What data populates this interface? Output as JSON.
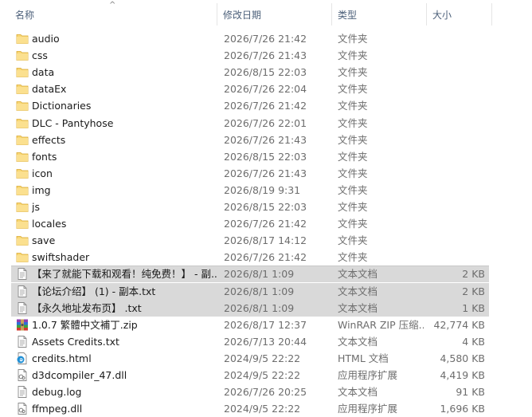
{
  "columns": {
    "name": "名称",
    "date": "修改日期",
    "type": "类型",
    "size": "大小",
    "sort_indicator": "^"
  },
  "colors": {
    "folder": "#f8d775",
    "selection": "#d9d9d9",
    "header_text": "#4c607a"
  },
  "files": [
    {
      "name": "audio",
      "date": "2026/7/26 21:42",
      "type": "文件夹",
      "size": "",
      "icon": "folder-icon",
      "selected": false
    },
    {
      "name": "css",
      "date": "2026/7/26 21:43",
      "type": "文件夹",
      "size": "",
      "icon": "folder-icon",
      "selected": false
    },
    {
      "name": "data",
      "date": "2026/8/15 22:03",
      "type": "文件夹",
      "size": "",
      "icon": "folder-icon",
      "selected": false
    },
    {
      "name": "dataEx",
      "date": "2026/7/26 22:04",
      "type": "文件夹",
      "size": "",
      "icon": "folder-icon",
      "selected": false
    },
    {
      "name": "Dictionaries",
      "date": "2026/7/26 21:42",
      "type": "文件夹",
      "size": "",
      "icon": "folder-icon",
      "selected": false
    },
    {
      "name": "DLC - Pantyhose",
      "date": "2026/7/26 22:01",
      "type": "文件夹",
      "size": "",
      "icon": "folder-icon",
      "selected": false
    },
    {
      "name": "effects",
      "date": "2026/7/26 21:43",
      "type": "文件夹",
      "size": "",
      "icon": "folder-icon",
      "selected": false
    },
    {
      "name": "fonts",
      "date": "2026/8/15 22:03",
      "type": "文件夹",
      "size": "",
      "icon": "folder-icon",
      "selected": false
    },
    {
      "name": "icon",
      "date": "2026/7/26 21:43",
      "type": "文件夹",
      "size": "",
      "icon": "folder-icon",
      "selected": false
    },
    {
      "name": "img",
      "date": "2026/8/19 9:31",
      "type": "文件夹",
      "size": "",
      "icon": "folder-icon",
      "selected": false
    },
    {
      "name": "js",
      "date": "2026/8/15 22:03",
      "type": "文件夹",
      "size": "",
      "icon": "folder-icon",
      "selected": false
    },
    {
      "name": "locales",
      "date": "2026/7/26 21:42",
      "type": "文件夹",
      "size": "",
      "icon": "folder-icon",
      "selected": false
    },
    {
      "name": "save",
      "date": "2026/8/17 14:12",
      "type": "文件夹",
      "size": "",
      "icon": "folder-icon",
      "selected": false
    },
    {
      "name": "swiftshader",
      "date": "2026/7/26 21:42",
      "type": "文件夹",
      "size": "",
      "icon": "folder-icon",
      "selected": false
    },
    {
      "name": "【来了就能下载和观看！纯免费！】 - 副...",
      "date": "2026/8/1 1:09",
      "type": "文本文档",
      "size": "2 KB",
      "icon": "text-file-icon",
      "selected": true
    },
    {
      "name": "【论坛介绍】 (1) - 副本.txt",
      "date": "2026/8/1 1:09",
      "type": "文本文档",
      "size": "2 KB",
      "icon": "text-file-icon",
      "selected": true
    },
    {
      "name": "【永久地址发布页】 .txt",
      "date": "2026/8/1 1:09",
      "type": "文本文档",
      "size": "1 KB",
      "icon": "text-file-icon",
      "selected": true
    },
    {
      "name": "1.0.7 繁體中文補丁.zip",
      "date": "2026/8/17 12:37",
      "type": "WinRAR ZIP 压缩...",
      "size": "42,774 KB",
      "icon": "winrar-archive-icon",
      "selected": false
    },
    {
      "name": "Assets Credits.txt",
      "date": "2026/7/13 20:44",
      "type": "文本文档",
      "size": "4 KB",
      "icon": "text-file-icon",
      "selected": false
    },
    {
      "name": "credits.html",
      "date": "2024/9/5 22:22",
      "type": "HTML 文档",
      "size": "4,580 KB",
      "icon": "edge-html-icon",
      "selected": false
    },
    {
      "name": "d3dcompiler_47.dll",
      "date": "2024/9/5 22:22",
      "type": "应用程序扩展",
      "size": "4,419 KB",
      "icon": "dll-file-icon",
      "selected": false
    },
    {
      "name": "debug.log",
      "date": "2026/7/26 20:25",
      "type": "文本文档",
      "size": "91 KB",
      "icon": "text-file-icon",
      "selected": false
    },
    {
      "name": "ffmpeg.dll",
      "date": "2024/9/5 22:22",
      "type": "应用程序扩展",
      "size": "1,696 KB",
      "icon": "dll-file-icon",
      "selected": false
    }
  ]
}
